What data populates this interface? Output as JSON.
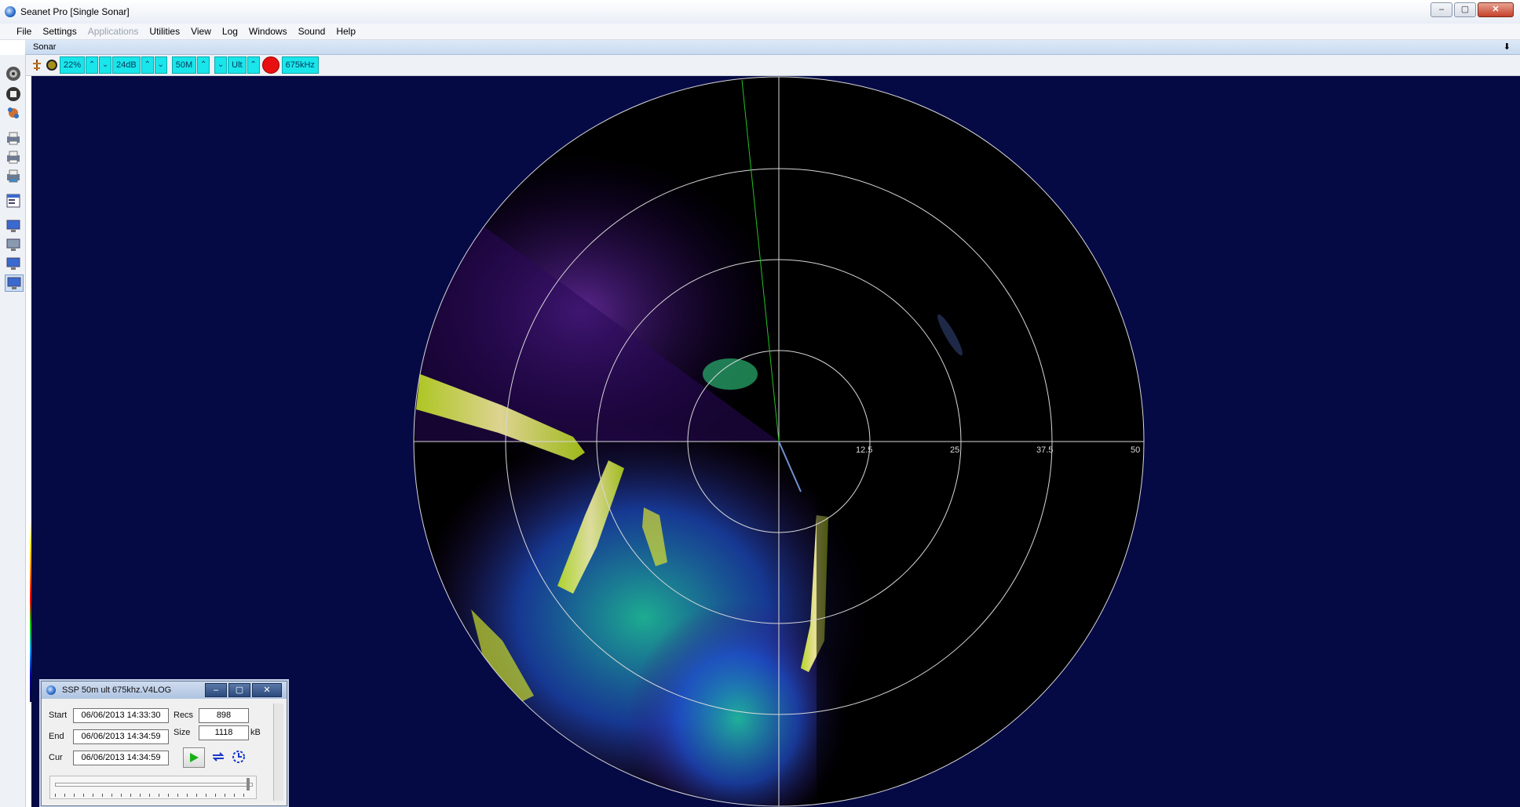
{
  "window": {
    "title": "Seanet Pro [Single Sonar]",
    "controls": {
      "minimize": "–",
      "maximize": "▢",
      "close": "✕"
    }
  },
  "menu": [
    {
      "label": "File",
      "enabled": true
    },
    {
      "label": "Settings",
      "enabled": true
    },
    {
      "label": "Applications",
      "enabled": false
    },
    {
      "label": "Utilities",
      "enabled": true
    },
    {
      "label": "View",
      "enabled": true
    },
    {
      "label": "Log",
      "enabled": true
    },
    {
      "label": "Windows",
      "enabled": true
    },
    {
      "label": "Sound",
      "enabled": true
    },
    {
      "label": "Help",
      "enabled": true
    }
  ],
  "panel": {
    "label": "Sonar",
    "pin_icon": "pin-icon"
  },
  "toolbar": {
    "gain": "22%",
    "contrast": "24dB",
    "range": "50M",
    "mode": "Ult",
    "frequency": "675kHz",
    "up_arrow": "⌃",
    "down_arrow": "⌄"
  },
  "sidebar_icons": [
    "disc-icon",
    "stop-icon",
    "satellite-icon",
    "printer-icon",
    "printer-setup-icon",
    "printer-color-icon",
    "window-layout-icon",
    "monitor-icon",
    "monitor-settings-icon",
    "monitor-network-icon",
    "monitor-active-icon"
  ],
  "sonar": {
    "range_labels": [
      "12.5",
      "25",
      "37.5",
      "50"
    ],
    "background_color": "#050a45",
    "display_color": "#000000",
    "grid_color": "#d8d8d8",
    "heading_line_color": "#22c322"
  },
  "log_window": {
    "title": "SSP 50m ult 675khz.V4LOG",
    "start_label": "Start",
    "start_value": "06/06/2013 14:33:30",
    "end_label": "End",
    "end_value": "06/06/2013 14:34:59",
    "cur_label": "Cur",
    "cur_value": "06/06/2013 14:34:59",
    "recs_label": "Recs",
    "recs_value": "898",
    "size_label": "Size",
    "size_value": "1118",
    "size_unit": "kB"
  }
}
